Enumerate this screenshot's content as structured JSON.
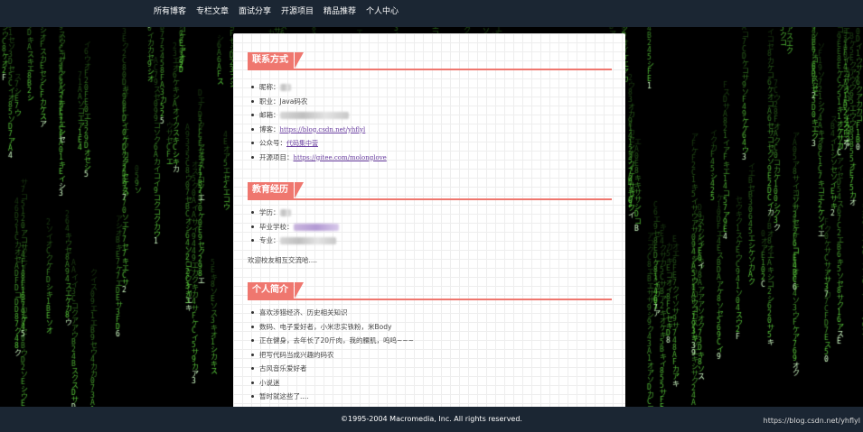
{
  "nav": {
    "items": [
      "所有博客",
      "专栏文章",
      "面试分享",
      "开源项目",
      "精品推荐",
      "个人中心"
    ]
  },
  "sections": {
    "contact": {
      "title": "联系方式",
      "items": [
        {
          "label": "昵称：",
          "value": ""
        },
        {
          "label": "职业：",
          "value": "Java码农"
        },
        {
          "label": "邮箱：",
          "value": ""
        },
        {
          "label": "博客：",
          "value": "https://blog.csdn.net/yhflyl"
        },
        {
          "label": "公众号：",
          "value": "代码集中营"
        },
        {
          "label": "开源项目：",
          "value": "https://gitee.com/molonglove"
        }
      ]
    },
    "education": {
      "title": "教育经历",
      "items": [
        {
          "label": "学历：",
          "value": ""
        },
        {
          "label": "毕业学校：",
          "value": ""
        },
        {
          "label": "专业：",
          "value": ""
        }
      ],
      "note": "欢迎校友相互交流哈...."
    },
    "profile": {
      "title": "个人简介",
      "items": [
        "喜欢涉猎经济、历史相关知识",
        "数码、电子爱好者，小米忠实铁粉，米Body",
        "正在健身，去年长了20斤肉，我的腰肌，呜呜~~~",
        "把写代码当成兴趣的码农",
        "古风音乐爱好者",
        "小说迷",
        "暂时就这些了...."
      ]
    }
  },
  "footer": {
    "copyright": "©1995-2004 Macromedia, Inc. All rights reserved."
  },
  "watermark": "https://blog.csdn.net/yhflyl",
  "colors": {
    "nav_bg": "#1b2633",
    "accent": "#ef776f",
    "link": "#6a3fa0",
    "matrix": "#5fd93f"
  }
}
